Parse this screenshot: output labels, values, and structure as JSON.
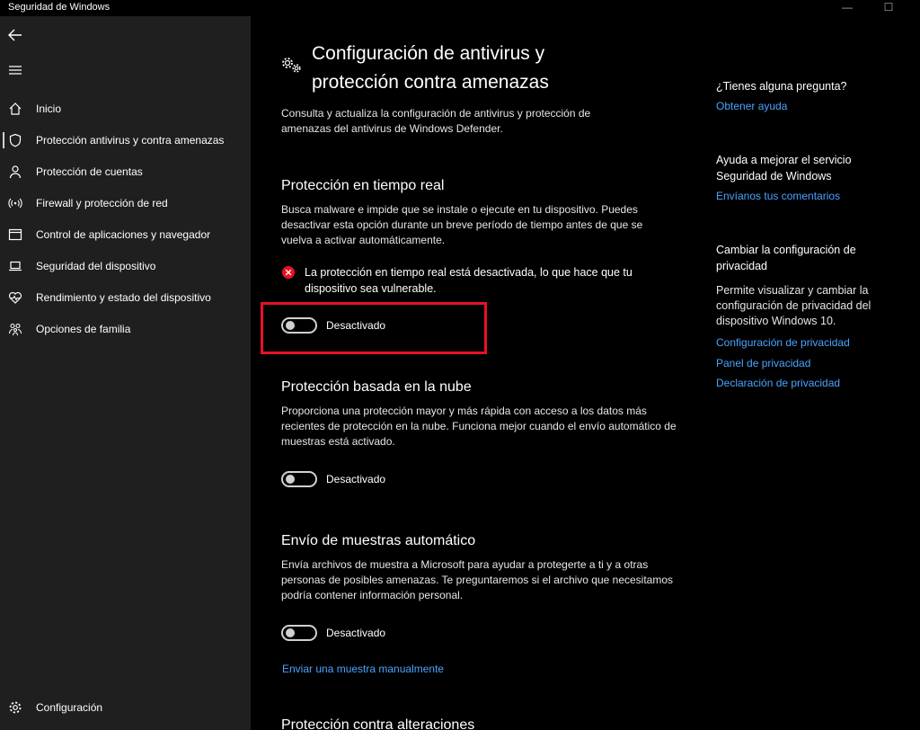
{
  "window": {
    "title": "Seguridad de Windows",
    "minimize": "—",
    "maximize": "☐"
  },
  "sidebar": {
    "items": [
      {
        "label": "Inicio",
        "icon": "home-icon"
      },
      {
        "label": "Protección antivirus y contra amenazas",
        "icon": "shield-icon",
        "active": true
      },
      {
        "label": "Protección de cuentas",
        "icon": "person-icon"
      },
      {
        "label": "Firewall y protección de red",
        "icon": "wifi-icon"
      },
      {
        "label": "Control de aplicaciones y navegador",
        "icon": "browser-icon"
      },
      {
        "label": "Seguridad del dispositivo",
        "icon": "laptop-icon"
      },
      {
        "label": "Rendimiento y estado del dispositivo",
        "icon": "heart-icon"
      },
      {
        "label": "Opciones de familia",
        "icon": "family-icon"
      }
    ],
    "settings_label": "Configuración"
  },
  "main": {
    "title": "Configuración de antivirus y protección contra amenazas",
    "description": "Consulta y actualiza la configuración de antivirus y protección de amenazas del antivirus de Windows Defender.",
    "realtime": {
      "heading": "Protección en tiempo real",
      "description": "Busca malware e impide que se instale o ejecute en tu dispositivo. Puedes desactivar esta opción durante un breve período de tiempo antes de que se vuelva a activar automáticamente.",
      "warning": "La protección en tiempo real está desactivada, lo que hace que tu dispositivo sea vulnerable.",
      "toggle_label": "Desactivado"
    },
    "cloud": {
      "heading": "Protección basada en la nube",
      "description": "Proporciona una protección mayor y más rápida con acceso a los datos más recientes de protección en la nube. Funciona mejor cuando el envío automático de muestras está activado.",
      "toggle_label": "Desactivado"
    },
    "samples": {
      "heading": "Envío de muestras automático",
      "description": "Envía archivos de muestra a Microsoft para ayudar a protegerte a ti y a otras personas de posibles amenazas. Te preguntaremos si el archivo que necesitamos podría contener información personal.",
      "toggle_label": "Desactivado",
      "manual_link": "Enviar una muestra manualmente"
    },
    "tamper": {
      "heading": "Protección contra alteraciones"
    }
  },
  "right": {
    "question_heading": "¿Tienes alguna pregunta?",
    "help_link": "Obtener ayuda",
    "improve_heading": "Ayuda a mejorar el servicio Seguridad de Windows",
    "feedback_link": "Envíanos tus comentarios",
    "privacy_heading": "Cambiar la configuración de privacidad",
    "privacy_text": "Permite visualizar y cambiar la configuración de privacidad del dispositivo Windows 10.",
    "privacy_links": [
      "Configuración de privacidad",
      "Panel de privacidad",
      "Declaración de privacidad"
    ]
  },
  "colors": {
    "accent_link": "#4aa3ff",
    "highlight": "#e81123",
    "sidebar_bg": "#1f1f1f"
  }
}
